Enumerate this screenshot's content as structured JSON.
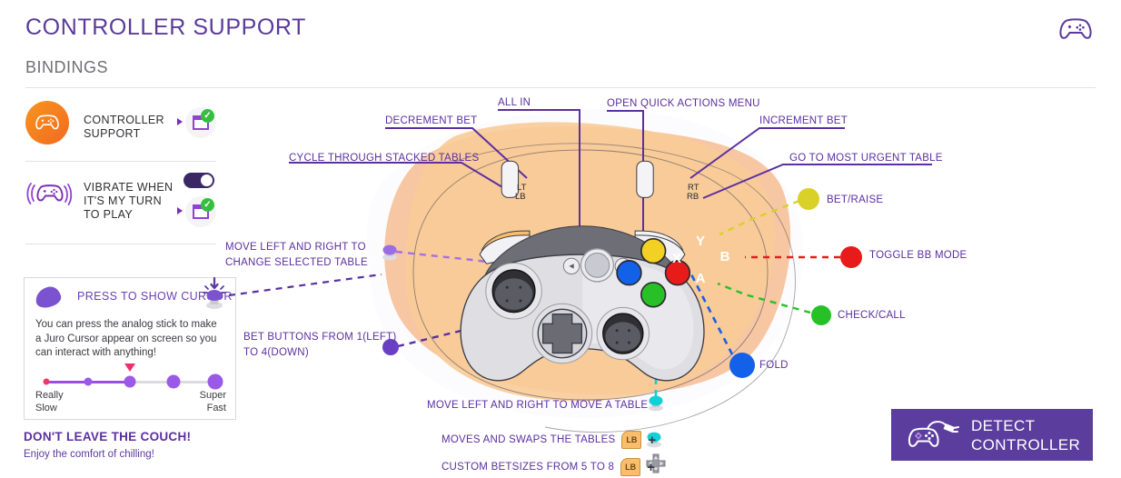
{
  "header": {
    "title": "CONTROLLER SUPPORT",
    "section": "BINDINGS",
    "gamepad_icon": "gamepad-icon"
  },
  "sidebar": {
    "rows": [
      {
        "label_line1": "CONTROLLER",
        "label_line2": "SUPPORT",
        "icon": "gamepad-filled-icon",
        "chip_icon": "enabled-check-icon",
        "has_toggle": false
      },
      {
        "label_line1": "VIBRATE WHEN",
        "label_line2": "IT'S MY TURN",
        "label_line3": "TO PLAY",
        "icon": "gamepad-vibrate-icon",
        "chip_icon": "enabled-check-icon",
        "has_toggle": true,
        "toggle_state": "on"
      }
    ]
  },
  "cursor_card": {
    "title": "PRESS TO SHOW CURSOR",
    "body": "You can press the analog stick to make a Juro Cursor appear on screen so you can interact with anything!",
    "slider": {
      "min_label_line1": "Really",
      "min_label_line2": "Slow",
      "max_label_line1": "Super",
      "max_label_line2": "Fast",
      "steps": 5,
      "selected_index": 2
    },
    "stick_icon": "analog-stick-press-icon"
  },
  "footer_note": {
    "title": "DON'T LEAVE THE COUCH!",
    "subtitle": "Enjoy the comfort of chilling!"
  },
  "diagram": {
    "labels": [
      {
        "id": "cycle-through-stacked-tables",
        "text": "CYCLE THROUGH STACKED TABLES"
      },
      {
        "id": "decrement-bet",
        "text": "DECREMENT BET"
      },
      {
        "id": "all-in",
        "text": "ALL IN"
      },
      {
        "id": "open-quick-actions-menu",
        "text": "OPEN QUICK ACTIONS MENU"
      },
      {
        "id": "increment-bet",
        "text": "INCREMENT BET"
      },
      {
        "id": "go-to-most-urgent-table",
        "text": "GO TO MOST URGENT TABLE"
      },
      {
        "id": "bet-raise",
        "text": "BET/RAISE"
      },
      {
        "id": "toggle-bb-mode",
        "text": "TOGGLE BB MODE"
      },
      {
        "id": "check-call",
        "text": "CHECK/CALL"
      },
      {
        "id": "fold",
        "text": "FOLD"
      },
      {
        "id": "move-left-right-change-table-1",
        "text": "MOVE LEFT AND RIGHT TO"
      },
      {
        "id": "move-left-right-change-table-2",
        "text": "CHANGE SELECTED TABLE"
      },
      {
        "id": "bet-buttons-1",
        "text": "BET BUTTONS FROM 1(LEFT)"
      },
      {
        "id": "bet-buttons-2",
        "text": "TO 4(DOWN)"
      },
      {
        "id": "move-left-right-move-table",
        "text": "MOVE LEFT AND RIGHT TO MOVE A TABLE"
      },
      {
        "id": "moves-and-swaps-tables",
        "text": "MOVES AND SWAPS THE TABLES"
      },
      {
        "id": "custom-betsizes",
        "text": "CUSTOM BETSIZES FROM 5 TO 8"
      }
    ],
    "controller_buttons": {
      "lt": "LT",
      "lb": "LB",
      "rt": "RT",
      "rb": "RB",
      "y": "Y",
      "b": "B",
      "x": "X",
      "a": "A"
    },
    "combo_key": "LB",
    "combo_plus": "+",
    "dot_colors": {
      "bet_raise": "#d9d02a",
      "toggle_bb": "#e81b1b",
      "check_call": "#27c127",
      "fold": "#1261e8",
      "purple": "#7b52cf",
      "cyan": "#13d0d6"
    }
  },
  "detect": {
    "label_line1": "DETECT",
    "label_line2": "CONTROLLER",
    "icon": "gamepad-plug-icon",
    "color": "#5b3d9e"
  },
  "colors": {
    "accent_purple": "#5b2fa0",
    "title_purple": "#5b3a9b",
    "orange": "#f7941e",
    "orange_dark": "#f26a21"
  }
}
